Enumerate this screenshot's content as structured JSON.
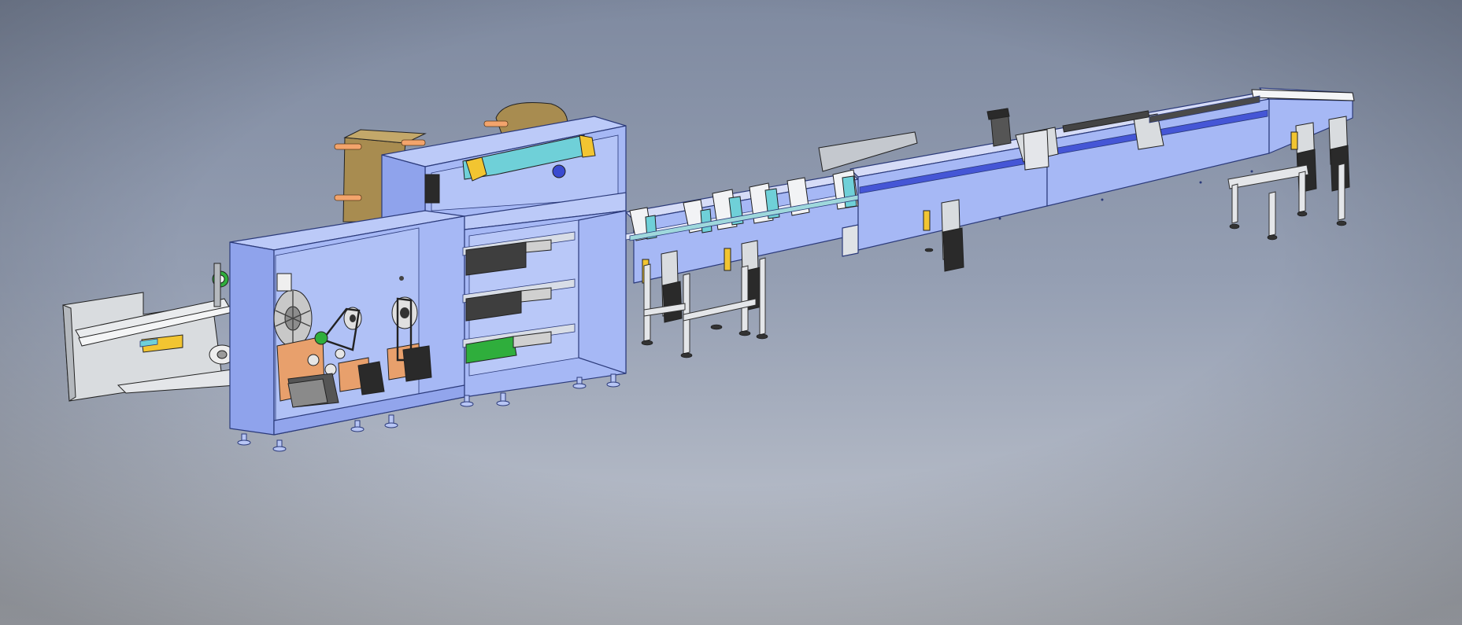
{
  "viewport": {
    "background_top": "#7f8aa0",
    "background_mid": "#959fb3",
    "background_bottom": "#c4c8d0"
  },
  "colors": {
    "frame_blue": "#a6b8f5",
    "frame_blue_light": "#bccaf8",
    "frame_blue_dark": "#8fa3ec",
    "deep_blue": "#4556d6",
    "edge": "#2b3a7a",
    "bronze": "#a88c50",
    "copper": "#e8a06c",
    "cyan": "#6fd0d8",
    "green": "#2fae3c",
    "yellow": "#f2c531",
    "steel": "#d9dcdf",
    "steel_dark": "#a9adb2",
    "black": "#262626"
  },
  "icons": [
    "wrapping-machine-cabinet",
    "film-roll-unwind",
    "servo-motor",
    "timing-belt-pulley",
    "conveyor-infeed",
    "stand-legs",
    "leveling-feet"
  ]
}
